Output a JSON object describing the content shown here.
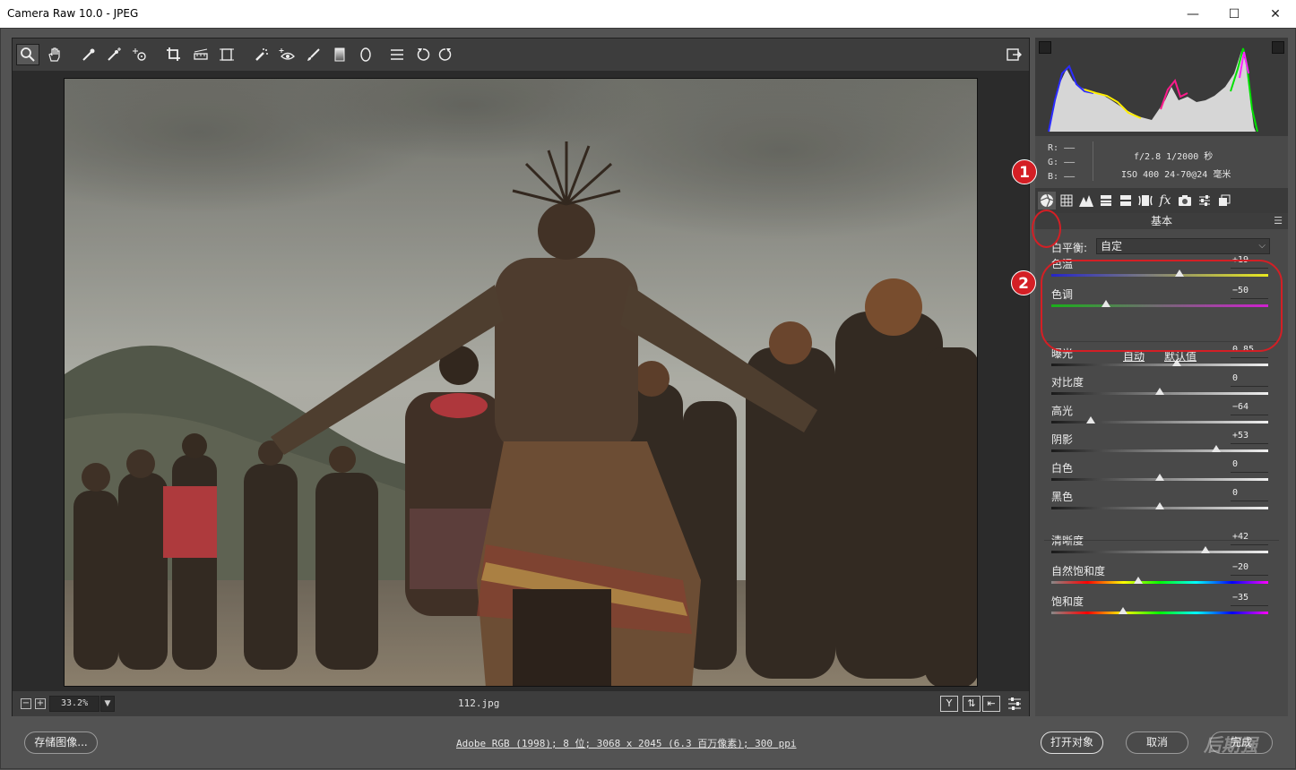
{
  "window": {
    "title": "Camera Raw 10.0 -  JPEG",
    "controls": [
      "—",
      "☐",
      "✕"
    ]
  },
  "toolbar": {
    "tools": [
      "zoom-tool",
      "hand-tool",
      "white-balance-tool",
      "color-sampler-tool",
      "targeted-adjustment-tool",
      "crop-tool",
      "straighten-tool",
      "transform-tool",
      "spot-removal-tool",
      "red-eye-removal-tool",
      "adjustment-brush-tool",
      "graduated-filter-tool",
      "radial-filter-tool",
      "preferences-tool",
      "rotate-ccw-tool",
      "rotate-cw-tool"
    ],
    "fullscreen": "fullscreen-toggle"
  },
  "status": {
    "zoom": "33.2%",
    "filename": "112.jpg",
    "view_y": "Y"
  },
  "histogram": {
    "rgb_labels": [
      "R:",
      "G:",
      "B:"
    ],
    "rgb_values": [
      "——",
      "——",
      "——"
    ],
    "exif_line1": "f/2.8   1/2000 秒",
    "exif_line2": "ISO 400   24-70@24 毫米"
  },
  "panel": {
    "title": "基本",
    "tabs": [
      "basic-tab",
      "tone-curve-tab",
      "detail-tab",
      "hsl-tab",
      "split-toning-tab",
      "lens-corrections-tab",
      "effects-tab",
      "camera-calibration-tab",
      "presets-tab",
      "snapshots-tab"
    ],
    "white_balance_label": "白平衡:",
    "white_balance_value": "自定",
    "auto_link": "自动",
    "default_link": "默认值",
    "sliders": [
      {
        "label": "色温",
        "value": "+19",
        "fraction": 0.59
      },
      {
        "label": "色调",
        "value": "−50",
        "fraction": 0.25
      },
      {
        "label": "曝光",
        "value": "0.85",
        "fraction": 0.58
      },
      {
        "label": "对比度",
        "value": "0",
        "fraction": 0.5
      },
      {
        "label": "高光",
        "value": "−64",
        "fraction": 0.18
      },
      {
        "label": "阴影",
        "value": "+53",
        "fraction": 0.76
      },
      {
        "label": "白色",
        "value": "0",
        "fraction": 0.5
      },
      {
        "label": "黑色",
        "value": "0",
        "fraction": 0.5
      },
      {
        "label": "清晰度",
        "value": "+42",
        "fraction": 0.71
      },
      {
        "label": "自然饱和度",
        "value": "−20",
        "fraction": 0.4
      },
      {
        "label": "饱和度",
        "value": "−35",
        "fraction": 0.33
      }
    ]
  },
  "annotations": {
    "one": "1",
    "two": "2"
  },
  "bottom": {
    "save_label": "存储图像...",
    "workflow": "Adobe RGB (1998); 8 位; 3068 x 2045 (6.3 百万像素); 300 ppi",
    "open_label": "打开对象",
    "cancel_label": "取消",
    "done_label": "完成",
    "watermark": "后期强"
  },
  "colors": {
    "accent_red": "#d41f25",
    "panel_bg": "#494949",
    "canvas_bg": "#2b2b2b"
  }
}
